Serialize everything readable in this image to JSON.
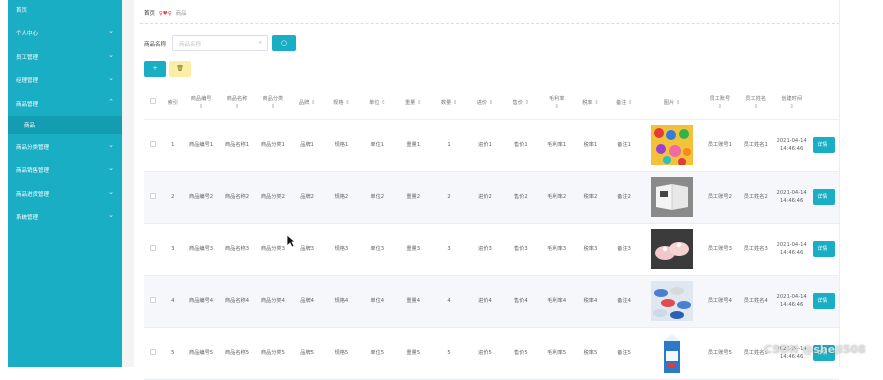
{
  "sidebar": {
    "items": [
      {
        "label": "首页",
        "chevron": false
      },
      {
        "label": "个人中心",
        "chevron": true
      },
      {
        "label": "员工管理",
        "chevron": true
      },
      {
        "label": "经理管理",
        "chevron": true
      },
      {
        "label": "商品管理",
        "chevron": true,
        "expanded": true
      },
      {
        "label": "商品分类管理",
        "chevron": true
      },
      {
        "label": "商品销售管理",
        "chevron": true
      },
      {
        "label": "商品进货管理",
        "chevron": true
      },
      {
        "label": "系统管理",
        "chevron": true
      }
    ],
    "sub_item": "商品"
  },
  "breadcrumb": {
    "home": "首页",
    "separator": "♀♥♀",
    "current": "商品"
  },
  "search": {
    "label": "商品名称",
    "placeholder": "商品名称",
    "button_icon": "search-icon"
  },
  "toolbar": {
    "add_icon": "add-icon",
    "delete_icon": "delete-icon"
  },
  "table": {
    "columns": [
      "",
      "索引",
      "商品编号",
      "商品名称",
      "商品分类",
      "品牌",
      "规格",
      "单位",
      "重量",
      "数量",
      "进价",
      "售价",
      "毛利率",
      "税率",
      "备注",
      "图片",
      "员工账号",
      "员工姓名",
      "创建时间",
      ""
    ],
    "rows": [
      {
        "index": "1",
        "code": "商品编号1",
        "name": "商品名称1",
        "category": "商品分类1",
        "brand": "品牌1",
        "spec": "规格1",
        "unit": "单位1",
        "weight": "重量1",
        "qty": "1",
        "cost": "进价1",
        "price": "售价1",
        "margin": "毛利率1",
        "tax": "税率1",
        "note": "备注1",
        "emp_account": "员工账号1",
        "emp_name": "员工姓名1",
        "created": "2021-04-14 14:46:46",
        "image": "colorful-candy"
      },
      {
        "index": "2",
        "code": "商品编号2",
        "name": "商品名称2",
        "category": "商品分类2",
        "brand": "品牌2",
        "spec": "规格2",
        "unit": "单位2",
        "weight": "重量2",
        "qty": "2",
        "cost": "进价2",
        "price": "售价2",
        "margin": "毛利率2",
        "tax": "税率2",
        "note": "备注2",
        "emp_account": "员工账号2",
        "emp_name": "员工姓名2",
        "created": "2021-04-14 14:46:46",
        "image": "open-book"
      },
      {
        "index": "3",
        "code": "商品编号3",
        "name": "商品名称3",
        "category": "商品分类3",
        "brand": "品牌3",
        "spec": "规格3",
        "unit": "单位3",
        "weight": "重量3",
        "qty": "3",
        "cost": "进价3",
        "price": "售价3",
        "margin": "毛利率3",
        "tax": "税率3",
        "note": "备注3",
        "emp_account": "员工账号3",
        "emp_name": "员工姓名3",
        "created": "2021-04-14 14:46:46",
        "image": "pink-shoes"
      },
      {
        "index": "4",
        "code": "商品编号4",
        "name": "商品名称4",
        "category": "商品分类4",
        "brand": "品牌4",
        "spec": "规格4",
        "unit": "单位4",
        "weight": "重量4",
        "qty": "4",
        "cost": "进价4",
        "price": "售价4",
        "margin": "毛利率4",
        "tax": "税率4",
        "note": "备注4",
        "emp_account": "员工账号4",
        "emp_name": "员工姓名4",
        "created": "2021-04-14 14:46:46",
        "image": "candy-pile"
      },
      {
        "index": "5",
        "code": "商品编号5",
        "name": "商品名称5",
        "category": "商品分类5",
        "brand": "品牌5",
        "spec": "规格5",
        "unit": "单位5",
        "weight": "重量5",
        "qty": "5",
        "cost": "进价5",
        "price": "售价5",
        "margin": "毛利率5",
        "tax": "税率5",
        "note": "备注5",
        "emp_account": "员工账号5",
        "emp_name": "员工姓名5",
        "created": "2021-04-14 14:46:46",
        "image": "milk-carton"
      }
    ],
    "action_label": "详情"
  },
  "watermark": "CSDN @sheji508",
  "colors": {
    "accent": "#1aaec4",
    "sidebar_sub": "#129db2",
    "delete_btn": "#fbeea6",
    "sep": "#e8474c"
  }
}
